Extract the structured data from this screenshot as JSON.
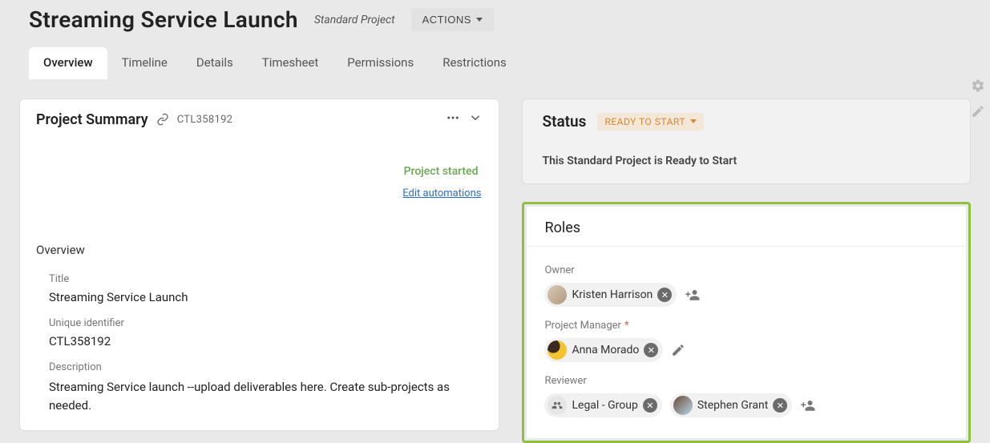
{
  "header": {
    "title": "Streaming Service Launch",
    "project_type": "Standard Project",
    "actions_label": "ACTIONS"
  },
  "tabs": [
    {
      "label": "Overview",
      "active": true
    },
    {
      "label": "Timeline",
      "active": false
    },
    {
      "label": "Details",
      "active": false
    },
    {
      "label": "Timesheet",
      "active": false
    },
    {
      "label": "Permissions",
      "active": false
    },
    {
      "label": "Restrictions",
      "active": false
    }
  ],
  "summary": {
    "card_title": "Project Summary",
    "project_id": "CTL358192",
    "started_label": "Project started",
    "edit_automations": "Edit automations",
    "section_label": "Overview",
    "fields": {
      "title_label": "Title",
      "title_value": "Streaming Service Launch",
      "uid_label": "Unique identifier",
      "uid_value": "CTL358192",
      "desc_label": "Description",
      "desc_value": "Streaming Service launch --upload deliverables here. Create sub-projects as needed."
    }
  },
  "status": {
    "title": "Status",
    "badge": "READY TO START",
    "description": "This Standard Project is Ready to Start"
  },
  "roles": {
    "title": "Roles",
    "owner": {
      "label": "Owner",
      "people": [
        {
          "name": "Kristen Harrison",
          "avatar": "kristen",
          "type": "person"
        }
      ]
    },
    "project_manager": {
      "label": "Project Manager",
      "required": true,
      "people": [
        {
          "name": "Anna Morado",
          "avatar": "anna",
          "type": "person"
        }
      ]
    },
    "reviewer": {
      "label": "Reviewer",
      "people": [
        {
          "name": "Legal - Group",
          "type": "group"
        },
        {
          "name": "Stephen Grant",
          "avatar": "stephen",
          "type": "person"
        }
      ]
    }
  }
}
